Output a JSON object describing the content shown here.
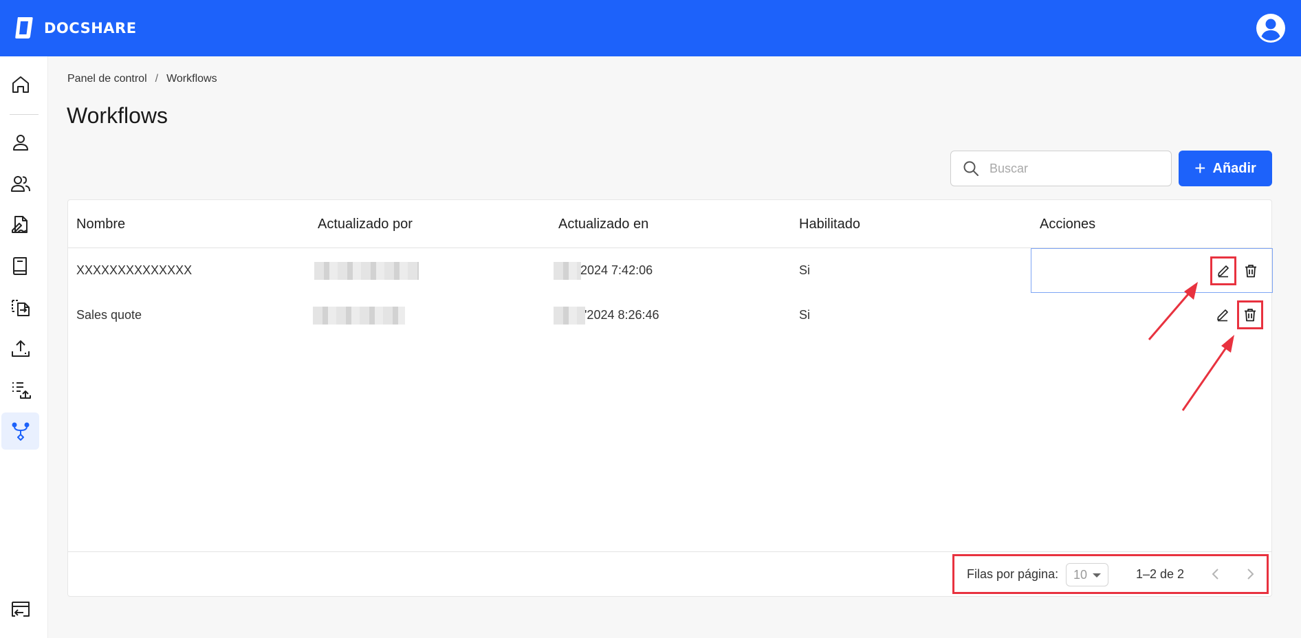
{
  "app": {
    "name": "DOCSHARE"
  },
  "breadcrumb": {
    "items": [
      "Panel de control",
      "Workflows"
    ],
    "separator": "/"
  },
  "page": {
    "title": "Workflows"
  },
  "search": {
    "placeholder": "Buscar",
    "value": ""
  },
  "toolbar": {
    "add_label": "Añadir"
  },
  "table": {
    "columns": [
      "Nombre",
      "Actualizado por",
      "Actualizado en",
      "Habilitado",
      "Acciones"
    ],
    "rows": [
      {
        "name": "XXXXXXXXXXXXXX",
        "updated_at": "2024 7:42:06",
        "enabled": "Si"
      },
      {
        "name": "Sales quote",
        "updated_at": "'2024 8:26:46",
        "enabled": "Si"
      }
    ]
  },
  "pagination": {
    "rows_label": "Filas por página:",
    "rows_per_page": "10",
    "range": "1–2 de 2"
  },
  "sidebar": {
    "items": [
      "home-icon",
      "user-icon",
      "users-icon",
      "document-signature-icon",
      "book-icon",
      "file-transfer-icon",
      "upload-icon",
      "list-upload-icon",
      "workflow-icon",
      "logout-icon"
    ],
    "active": "workflow-icon"
  },
  "colors": {
    "primary": "#1d62fa",
    "highlight": "#e8323f",
    "active_bg": "#e9f0fe"
  }
}
